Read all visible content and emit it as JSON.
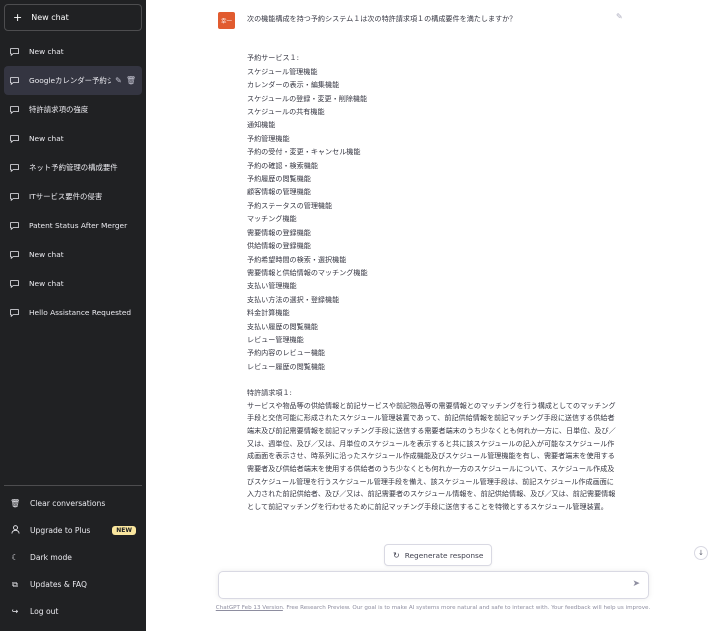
{
  "sidebar": {
    "new_chat_label": "New chat",
    "history": [
      {
        "label": "New chat",
        "active": false
      },
      {
        "label": "Googleカレンダー予約システム",
        "active": true
      },
      {
        "label": "特許請求項の強度",
        "active": false
      },
      {
        "label": "New chat",
        "active": false
      },
      {
        "label": "ネット予約管理の構成要件",
        "active": false
      },
      {
        "label": "ITサービス要件の侵害",
        "active": false
      },
      {
        "label": "Patent Status After Merger",
        "active": false
      },
      {
        "label": "New chat",
        "active": false
      },
      {
        "label": "New chat",
        "active": false
      },
      {
        "label": "Hello Assistance Requested",
        "active": false
      }
    ],
    "menu": {
      "clear": "Clear conversations",
      "upgrade": "Upgrade to Plus",
      "new_badge": "NEW",
      "dark": "Dark mode",
      "updates": "Updates & FAQ",
      "logout": "Log out"
    }
  },
  "message": {
    "avatar_text": "幸一",
    "question": "次の機能構成を持つ予約システム１は次の特許請求項１の構成要件を満たしますか？",
    "service_heading": "予約サービス１:",
    "service_features": [
      "スケジュール管理機能",
      "カレンダーの表示・編集機能",
      "スケジュールの登録・変更・削除機能",
      "スケジュールの共有機能",
      "通知機能",
      "予約管理機能",
      "予約の受付・変更・キャンセル機能",
      "予約の確認・検索機能",
      "予約履歴の閲覧機能",
      "顧客情報の管理機能",
      "予約ステータスの管理機能",
      "マッチング機能",
      "需要情報の登録機能",
      "供給情報の登録機能",
      "予約希望時間の検索・選択機能",
      "需要情報と供給情報のマッチング機能",
      "支払い管理機能",
      "支払い方法の選択・登録機能",
      "料金計算機能",
      "支払い履歴の閲覧機能",
      "レビュー管理機能",
      "予約内容のレビュー機能",
      "レビュー履歴の閲覧機能"
    ],
    "claim_heading": "特許請求項１:",
    "claim_text": "サービスや物品等の供給情報と前記サービスや前記物品等の需要情報とのマッチングを行う構成としてのマッチング手段と交信可能に形成されたスケジュール管理装置であって、前記供給情報を前記マッチング手段に送信する供給者端末及び前記需要情報を前記マッチング手段に送信する需要者端末のうち少なくとも何れか一方に、日単位、及び／又は、週単位、及び／又は、月単位のスケジュールを表示すると共に該スケジュールの記入が可能なスケジュール作成画面を表示させ、時系列に沿ったスケジュール作成機能及びスケジュール管理機能を有し、需要者端末を使用する需要者及び供給者端末を使用する供給者のうち少なくとも何れか一方のスケジュールについて、スケジュール作成及びスケジュール管理を行うスケジュール管理手段を備え、該スケジュール管理手段は、前記スケジュール作成画面に入力された前記供給者、及び／又は、前記需要者のスケジュール情報を、前記供給情報、及び／又は、前記需要情報として前記マッチングを行わせるために前記マッチング手段に送信することを特徴とするスケジュール管理装置。"
  },
  "regenerate_label": "Regenerate response",
  "input": {
    "placeholder": "",
    "value": ""
  },
  "footer": {
    "link": "ChatGPT Feb 13 Version",
    "text": ". Free Research Preview. Our goal is to make AI systems more natural and safe to interact with. Your feedback will help us improve."
  },
  "colors": {
    "sidebar_bg": "#202123",
    "avatar_bg": "#e15b2f",
    "badge_bg": "#fae69e"
  }
}
